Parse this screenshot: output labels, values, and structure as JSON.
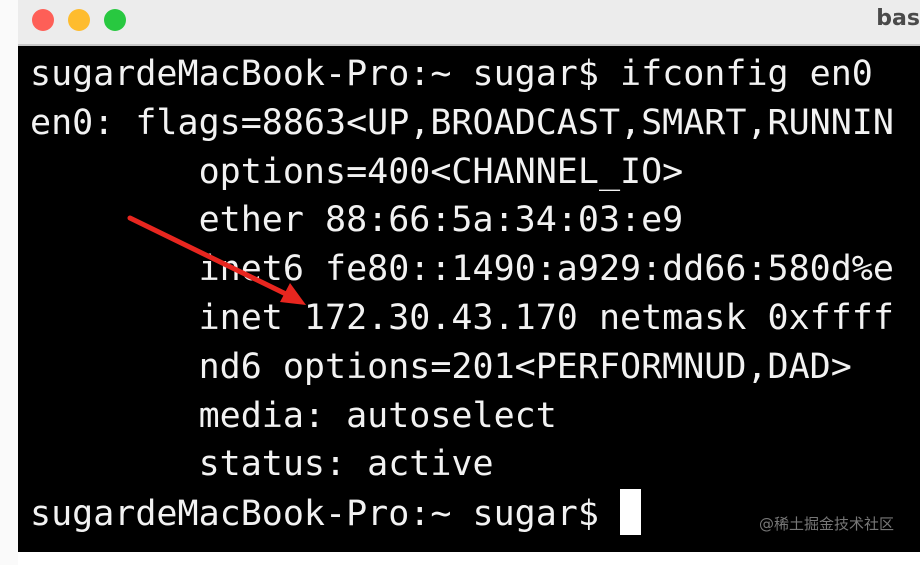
{
  "window": {
    "title": "bas"
  },
  "terminal": {
    "lines": [
      "sugardeMacBook-Pro:~ sugar$ ifconfig en0",
      "en0: flags=8863<UP,BROADCAST,SMART,RUNNIN",
      "        options=400<CHANNEL_IO>",
      "        ether 88:66:5a:34:03:e9",
      "        inet6 fe80::1490:a929:dd66:580d%e",
      "        inet 172.30.43.170 netmask 0xffff",
      "        nd6 options=201<PERFORMNUD,DAD>",
      "        media: autoselect",
      "        status: active"
    ],
    "prompt": "sugardeMacBook-Pro:~ sugar$ "
  },
  "watermark": "@稀土掘金技术社区",
  "colors": {
    "close": "#fe5f57",
    "minimize": "#febc2e",
    "zoom": "#28c840",
    "arrow": "#e8261f"
  }
}
